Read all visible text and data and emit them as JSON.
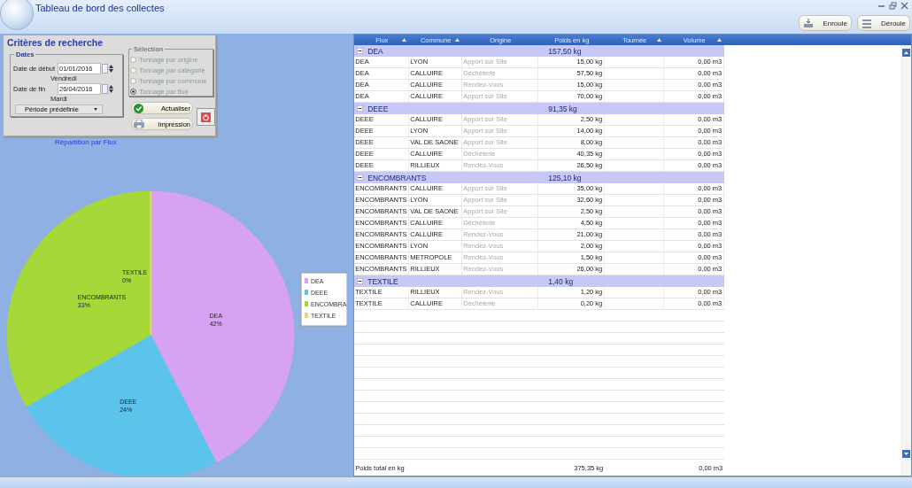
{
  "window": {
    "title": "Tableau de bord des collectes"
  },
  "toolbar": {
    "buttons": [
      {
        "label": "Enroule",
        "kind": "collapse"
      },
      {
        "label": "Déroule",
        "kind": "expand"
      }
    ]
  },
  "criteria": {
    "title": "Critères de recherche",
    "dates": {
      "legend": "Dates",
      "fields": [
        {
          "label": "Date de début",
          "value": "01/01/2016",
          "weekday": "Vendredi"
        },
        {
          "label": "Date de fin",
          "value": "26/04/2016",
          "weekday": "Mardi"
        }
      ],
      "period": "Période prédéfinie"
    },
    "selection": {
      "legend": "Sélection",
      "options": [
        {
          "label": "Tonnage par origine",
          "selected": false
        },
        {
          "label": "Tonnage par catégorie",
          "selected": false
        },
        {
          "label": "Tonnage par commune",
          "selected": false
        },
        {
          "label": "Tonnage par flux",
          "selected": true
        }
      ]
    },
    "buttons": [
      {
        "label": "Actualiser",
        "kind": "refresh"
      },
      {
        "label": "Impression",
        "kind": "print"
      },
      {
        "kind": "power"
      }
    ]
  },
  "chart": {
    "chart_data": {
      "type": "pie",
      "title": "Répartition par Flux",
      "categories": [
        "DEA",
        "DEEE",
        "ENCOMBRANTS",
        "TEXTILE"
      ],
      "values": [
        42,
        24,
        33,
        0
      ],
      "value_labels": [
        "42%",
        "24%",
        "33%",
        "0%"
      ]
    },
    "legend": [
      {
        "label": "DEA",
        "color": "#d8a2f2"
      },
      {
        "label": "DEEE",
        "color": "#5cc4ea"
      },
      {
        "label": "ENCOMBRA",
        "color": "#a6d83a"
      },
      {
        "label": "TEXTILE",
        "color": "#f2d080"
      }
    ]
  },
  "grid": {
    "columns": [
      {
        "label": "Flux",
        "filter": true
      },
      {
        "label": "Commune",
        "filter": true
      },
      {
        "label": "Origine",
        "filter": false
      },
      {
        "label": "Poids en kg",
        "filter": false
      },
      {
        "label": "Tournée",
        "filter": true
      },
      {
        "label": "Volume",
        "filter": true
      }
    ],
    "groups": [
      {
        "label": "DEA",
        "total": "157,50 kg",
        "expanded": true,
        "rows": [
          {
            "flux": "DEA",
            "commune": "LYON",
            "origine": "Apport sur Site",
            "poids": "15,00 kg",
            "volume": "0,00 m3"
          },
          {
            "flux": "DEA",
            "commune": "CALLUIRE",
            "origine": "Déchèterie",
            "poids": "57,50 kg",
            "volume": "0,00 m3"
          },
          {
            "flux": "DEA",
            "commune": "CALLUIRE",
            "origine": "Rendez-Vous",
            "poids": "15,00 kg",
            "volume": "0,00 m3"
          },
          {
            "flux": "DEA",
            "commune": "CALLUIRE",
            "origine": "Apport sur Site",
            "poids": "70,00 kg",
            "volume": "0,00 m3"
          }
        ]
      },
      {
        "label": "DEEE",
        "total": "91,35 kg",
        "expanded": true,
        "rows": [
          {
            "flux": "DEEE",
            "commune": "CALLUIRE",
            "origine": "Apport sur Site",
            "poids": "2,50 kg",
            "volume": "0,00 m3"
          },
          {
            "flux": "DEEE",
            "commune": "LYON",
            "origine": "Apport sur Site",
            "poids": "14,00 kg",
            "volume": "0,00 m3"
          },
          {
            "flux": "DEEE",
            "commune": "VAL DE SAONE",
            "origine": "Apport sur Site",
            "poids": "8,00 kg",
            "volume": "0,00 m3"
          },
          {
            "flux": "DEEE",
            "commune": "CALLUIRE",
            "origine": "Déchèterie",
            "poids": "40,35 kg",
            "volume": "0,00 m3"
          },
          {
            "flux": "DEEE",
            "commune": "RILLIEUX",
            "origine": "Rendez-Vous",
            "poids": "26,50 kg",
            "volume": "0,00 m3"
          }
        ]
      },
      {
        "label": "ENCOMBRANTS",
        "total": "125,10 kg",
        "expanded": true,
        "rows": [
          {
            "flux": "ENCOMBRANTS",
            "commune": "CALLUIRE",
            "origine": "Apport sur Site",
            "poids": "35,00 kg",
            "volume": "0,00 m3"
          },
          {
            "flux": "ENCOMBRANTS",
            "commune": "LYON",
            "origine": "Apport sur Site",
            "poids": "32,60 kg",
            "volume": "0,00 m3"
          },
          {
            "flux": "ENCOMBRANTS",
            "commune": "VAL DE SAONE",
            "origine": "Apport sur Site",
            "poids": "2,50 kg",
            "volume": "0,00 m3"
          },
          {
            "flux": "ENCOMBRANTS",
            "commune": "CALLUIRE",
            "origine": "Déchèterie",
            "poids": "4,50 kg",
            "volume": "0,00 m3"
          },
          {
            "flux": "ENCOMBRANTS",
            "commune": "CALLUIRE",
            "origine": "Rendez-Vous",
            "poids": "21,00 kg",
            "volume": "0,00 m3"
          },
          {
            "flux": "ENCOMBRANTS",
            "commune": "LYON",
            "origine": "Rendez-Vous",
            "poids": "2,00 kg",
            "volume": "0,00 m3"
          },
          {
            "flux": "ENCOMBRANTS",
            "commune": "METROPOLE",
            "origine": "Rendez-Vous",
            "poids": "1,50 kg",
            "volume": "0,00 m3"
          },
          {
            "flux": "ENCOMBRANTS",
            "commune": "RILLIEUX",
            "origine": "Rendez-Vous",
            "poids": "26,00 kg",
            "volume": "0,00 m3"
          }
        ]
      },
      {
        "label": "TEXTILE",
        "total": "1,40 kg",
        "expanded": true,
        "rows": [
          {
            "flux": "TEXTILE",
            "commune": "RILLIEUX",
            "origine": "Rendez-Vous",
            "poids": "1,20 kg",
            "volume": "0,00 m3"
          },
          {
            "flux": "TEXTILE",
            "commune": "CALLUIRE",
            "origine": "Déchèterie",
            "poids": "0,20 kg",
            "volume": "0,00 m3"
          }
        ]
      }
    ],
    "footer": {
      "label": "Poids total en kg",
      "poids": "375,35 kg",
      "volume": "0,00 m3"
    }
  }
}
